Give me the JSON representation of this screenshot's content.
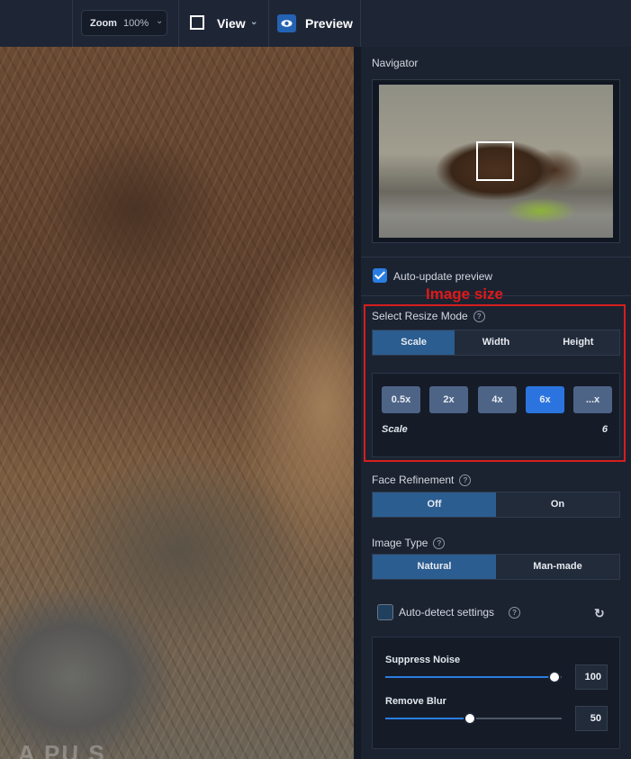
{
  "toolbar": {
    "zoom_label": "Zoom",
    "zoom_value": "100%",
    "view_label": "View",
    "preview_label": "Preview"
  },
  "watermark": "A  PU  S",
  "panel": {
    "navigator_title": "Navigator",
    "auto_update_label": "Auto-update preview",
    "auto_update_checked": true,
    "annotation": "Image size",
    "resize_mode": {
      "title": "Select Resize Mode",
      "tabs": [
        "Scale",
        "Width",
        "Height"
      ],
      "active_tab": 0,
      "scale_buttons": [
        "0.5x",
        "2x",
        "4x",
        "6x",
        "...x"
      ],
      "active_scale": 3,
      "scale_label": "Scale",
      "scale_value": "6"
    },
    "face_refinement": {
      "title": "Face Refinement",
      "options": [
        "Off",
        "On"
      ],
      "active": 0
    },
    "image_type": {
      "title": "Image Type",
      "options": [
        "Natural",
        "Man-made"
      ],
      "active": 0
    },
    "auto_detect_label": "Auto-detect settings",
    "auto_detect_checked": false,
    "suppress_noise": {
      "label": "Suppress Noise",
      "value": "100",
      "level": 100
    },
    "remove_blur": {
      "label": "Remove Blur",
      "value": "50",
      "level": 50
    }
  },
  "colors": {
    "accent": "#2a7de1",
    "active_segment": "#2b5d90",
    "annotation_red": "#d61e1e"
  }
}
